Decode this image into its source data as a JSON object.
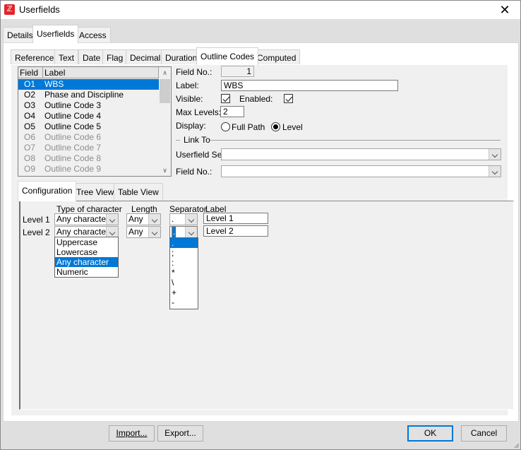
{
  "window": {
    "title": "Userfields",
    "app_icon": "app-logo-icon",
    "close_icon": "close-icon"
  },
  "top_tabs": [
    {
      "label": "Details",
      "active": false
    },
    {
      "label": "Userfields",
      "active": true
    },
    {
      "label": "Access",
      "active": false
    }
  ],
  "type_tabs": [
    {
      "label": "Reference",
      "active": false
    },
    {
      "label": "Text",
      "active": false
    },
    {
      "label": "Date",
      "active": false
    },
    {
      "label": "Flag",
      "active": false
    },
    {
      "label": "Decimal",
      "active": false
    },
    {
      "label": "Duration",
      "active": false
    },
    {
      "label": "Outline Codes",
      "active": true
    },
    {
      "label": "Computed",
      "active": false
    }
  ],
  "field_list": {
    "columns": [
      "Field",
      "Label"
    ],
    "rows": [
      {
        "code": "O1",
        "label": "WBS",
        "selected": true,
        "enabled": true
      },
      {
        "code": "O2",
        "label": "Phase and Discipline",
        "selected": false,
        "enabled": true
      },
      {
        "code": "O3",
        "label": "Outline Code 3",
        "selected": false,
        "enabled": true
      },
      {
        "code": "O4",
        "label": "Outline Code 4",
        "selected": false,
        "enabled": true
      },
      {
        "code": "O5",
        "label": "Outline Code 5",
        "selected": false,
        "enabled": true
      },
      {
        "code": "O6",
        "label": "Outline Code 6",
        "selected": false,
        "enabled": false
      },
      {
        "code": "O7",
        "label": "Outline Code 7",
        "selected": false,
        "enabled": false
      },
      {
        "code": "O8",
        "label": "Outline Code 8",
        "selected": false,
        "enabled": false
      },
      {
        "code": "O9",
        "label": "Outline Code 9",
        "selected": false,
        "enabled": false
      }
    ]
  },
  "details": {
    "field_no_label": "Field No.:",
    "field_no_value": "1",
    "label_label": "Label:",
    "label_value": "WBS",
    "visible_label": "Visible:",
    "visible_checked": true,
    "enabled_label": "Enabled:",
    "enabled_checked": true,
    "max_levels_label": "Max Levels:",
    "max_levels_value": "2",
    "display_label": "Display:",
    "display_options": [
      "Full Path",
      "Level"
    ],
    "display_selected": "Level",
    "link_to_title": "Link To",
    "userfield_set_label": "Userfield Set:",
    "userfield_set_value": "",
    "link_field_no_label": "Field No.:",
    "link_field_no_value": ""
  },
  "sub_tabs": [
    {
      "label": "Configuration",
      "active": true
    },
    {
      "label": "Tree View",
      "active": false
    },
    {
      "label": "Table View",
      "active": false
    }
  ],
  "configuration": {
    "headers": {
      "type": "Type of character",
      "length": "Length",
      "separator": "Separator",
      "label": "Label"
    },
    "levels": [
      {
        "name": "Level 1",
        "type": "Any character",
        "length": "Any",
        "separator": ".",
        "label": "Level 1"
      },
      {
        "name": "Level 2",
        "type": "Any character",
        "length": "Any",
        "separator": ".",
        "label": "Level 2"
      }
    ],
    "type_dropdown": {
      "options": [
        "Uppercase",
        "Lowercase",
        "Any character",
        "Numeric"
      ],
      "selected": "Any character"
    },
    "separator_dropdown": {
      "options": [
        ".",
        ";",
        ":",
        "*",
        "\\",
        "+",
        "-"
      ],
      "selected": "."
    }
  },
  "buttons": {
    "import": "Import...",
    "export": "Export...",
    "ok": "OK",
    "cancel": "Cancel"
  }
}
